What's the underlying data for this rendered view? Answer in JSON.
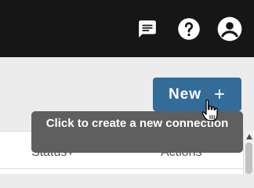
{
  "topbar": {
    "icons": [
      "feedback-icon",
      "help-icon",
      "account-icon"
    ]
  },
  "new_button": {
    "label": "New",
    "icon": "+"
  },
  "tooltip": {
    "text": "Click to create a new connection"
  },
  "table": {
    "columns": [
      {
        "label": "Status",
        "sort_icon": "▾"
      },
      {
        "label": "Actions"
      }
    ]
  },
  "colors": {
    "topbar": "#161616",
    "accent": "#336b99",
    "tooltip_bg": "#5f5f5f",
    "content_bg": "#ececec"
  }
}
